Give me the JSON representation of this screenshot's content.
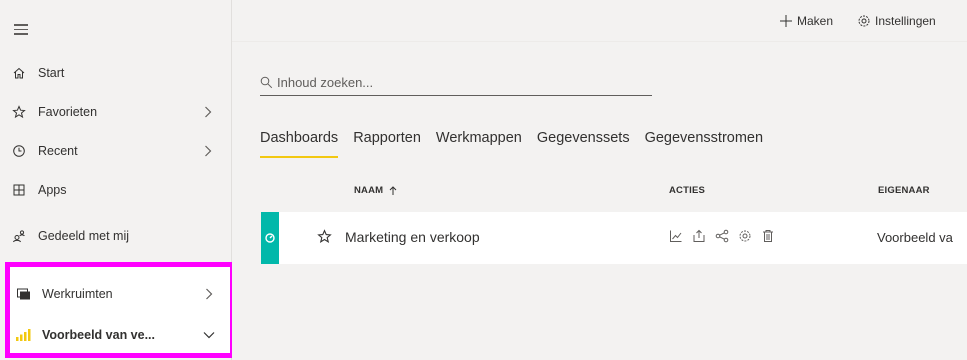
{
  "topbar": {
    "create_label": "Maken",
    "settings_label": "Instellingen"
  },
  "sidebar": {
    "items": [
      {
        "label": "Start"
      },
      {
        "label": "Favorieten"
      },
      {
        "label": "Recent"
      },
      {
        "label": "Apps"
      },
      {
        "label": "Gedeeld met mij"
      }
    ],
    "workspaces_label": "Werkruimten",
    "current_workspace_label": "Voorbeeld van ve..."
  },
  "search": {
    "placeholder": "Inhoud zoeken..."
  },
  "tabs": [
    {
      "label": "Dashboards",
      "active": true
    },
    {
      "label": "Rapporten"
    },
    {
      "label": "Werkmappen"
    },
    {
      "label": "Gegevenssets"
    },
    {
      "label": "Gegevensstromen"
    }
  ],
  "table": {
    "columns": {
      "name": "NAAM",
      "actions": "ACTIES",
      "owner": "EIGENAAR"
    },
    "rows": [
      {
        "name": "Marketing en verkoop",
        "owner": "Voorbeeld va"
      }
    ]
  },
  "colors": {
    "accent_tab": "#f2c811",
    "badge": "#01b8aa",
    "highlight": "#ff00ff"
  }
}
